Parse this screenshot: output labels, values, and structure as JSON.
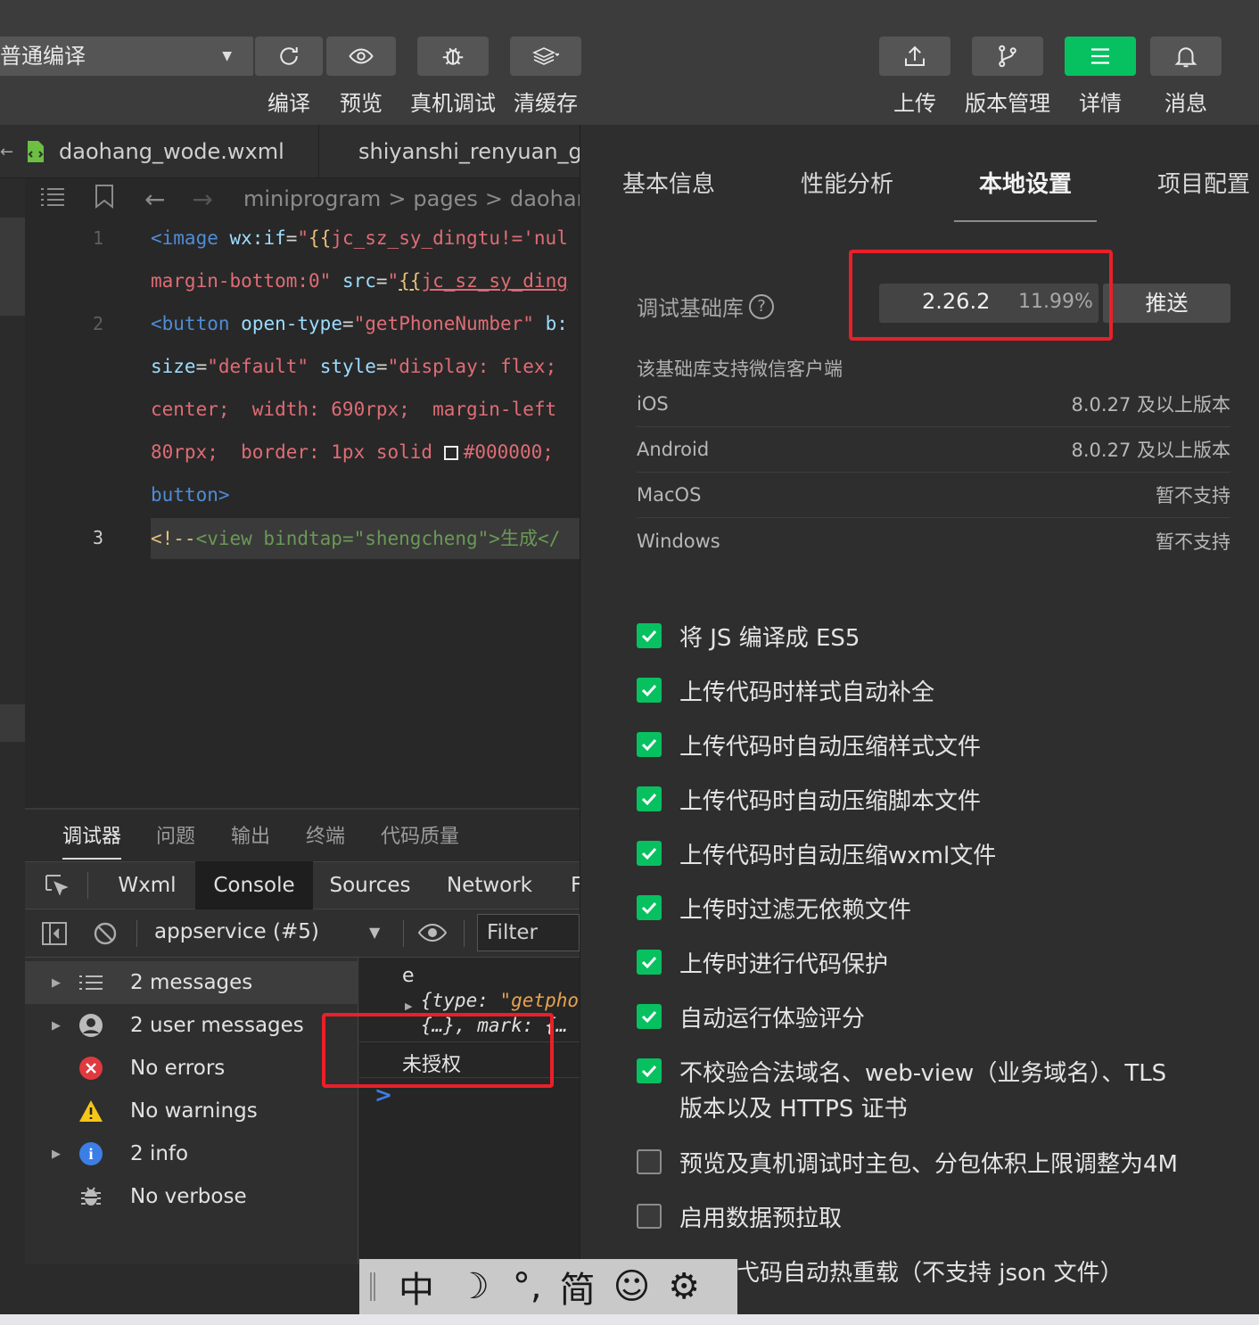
{
  "toolbar": {
    "compile_mode": "普通编译",
    "buttons": [
      {
        "label": "编译",
        "icon": "refresh-icon"
      },
      {
        "label": "预览",
        "icon": "eye-icon"
      },
      {
        "label": "真机调试",
        "icon": "bug-icon"
      },
      {
        "label": "清缓存",
        "icon": "layers-icon"
      }
    ],
    "right_buttons": [
      {
        "label": "上传",
        "icon": "upload-icon"
      },
      {
        "label": "版本管理",
        "icon": "branch-icon"
      },
      {
        "label": "详情",
        "icon": "menu-icon"
      },
      {
        "label": "消息",
        "icon": "bell-icon"
      }
    ]
  },
  "editor": {
    "tabs": [
      "daohang_wode.wxml",
      "shiyanshi_renyuan_g"
    ],
    "breadcrumb": [
      "miniprogram",
      "pages",
      "daohan"
    ],
    "line_numbers": [
      "1",
      "2",
      "3"
    ]
  },
  "debugger": {
    "tabs": [
      "调试器",
      "问题",
      "输出",
      "终端",
      "代码质量"
    ],
    "devtools_tabs": [
      "Wxml",
      "Console",
      "Sources",
      "Network",
      "F"
    ],
    "context": "appservice (#5)",
    "filter_placeholder": "Filter",
    "sidebar": [
      {
        "label": "2 messages",
        "icon": "list-icon"
      },
      {
        "label": "2 user messages",
        "icon": "user-icon"
      },
      {
        "label": "No errors",
        "icon": "error-icon"
      },
      {
        "label": "No warnings",
        "icon": "warning-icon"
      },
      {
        "label": "2 info",
        "icon": "info-icon"
      },
      {
        "label": "No verbose",
        "icon": "verbose-icon"
      }
    ],
    "console": {
      "line1": "e",
      "obj1_key": "{type: ",
      "obj1_val": "\"getpho",
      "obj2": "{…}, mark: {…",
      "message": "未授权",
      "prompt": ">"
    }
  },
  "details": {
    "tabs": [
      "基本信息",
      "性能分析",
      "本地设置",
      "项目配置"
    ],
    "lib_label": "调试基础库",
    "lib_version": "2.26.2",
    "lib_percent": "11.99%",
    "push_label": "推送",
    "support_label": "该基础库支持微信客户端",
    "platforms": [
      {
        "name": "iOS",
        "value": "8.0.27 及以上版本"
      },
      {
        "name": "Android",
        "value": "8.0.27 及以上版本"
      },
      {
        "name": "MacOS",
        "value": "暂不支持"
      },
      {
        "name": "Windows",
        "value": "暂不支持"
      }
    ],
    "options": [
      {
        "label": "将 JS 编译成 ES5",
        "checked": true
      },
      {
        "label": "上传代码时样式自动补全",
        "checked": true
      },
      {
        "label": "上传代码时自动压缩样式文件",
        "checked": true
      },
      {
        "label": "上传代码时自动压缩脚本文件",
        "checked": true
      },
      {
        "label": "上传代码时自动压缩wxml文件",
        "checked": true
      },
      {
        "label": "上传时过滤无依赖文件",
        "checked": true
      },
      {
        "label": "上传时进行代码保护",
        "checked": true
      },
      {
        "label": "自动运行体验评分",
        "checked": true
      },
      {
        "label": "不校验合法域名、web-view（业务域名）、TLS 版本以及 HTTPS 证书",
        "line1": "不校验合法域名、web-view（业务域名）、TLS",
        "line2": "版本以及 HTTPS 证书",
        "checked": true
      },
      {
        "label": "预览及真机调试时主包、分包体积上限调整为4M",
        "checked": false
      },
      {
        "label": "启用数据预拉取",
        "checked": false
      },
      {
        "label": "弋码自动热重载（不支持 json 文件）",
        "checked": false
      }
    ]
  },
  "ime": {
    "items": [
      "中",
      "☽",
      "°,",
      "简",
      "☺",
      "⚙"
    ]
  },
  "colors": {
    "accent_green": "#07c160",
    "annotation_red": "#e8202a"
  }
}
